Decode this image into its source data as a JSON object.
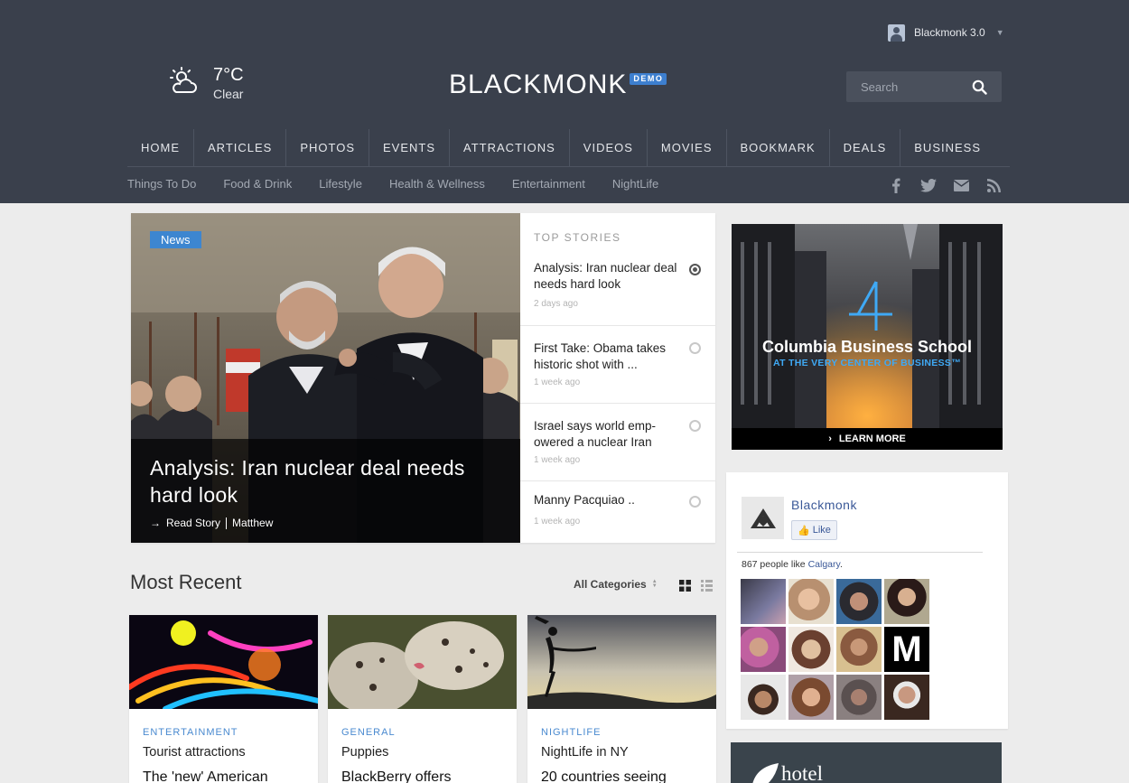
{
  "user": {
    "name": "Blackmonk 3.0"
  },
  "weather": {
    "temp": "7°C",
    "condition": "Clear"
  },
  "logo": {
    "text": "BLACKMONK",
    "badge": "DEMO"
  },
  "search": {
    "placeholder": "Search"
  },
  "nav": [
    "HOME",
    "ARTICLES",
    "PHOTOS",
    "EVENTS",
    "ATTRACTIONS",
    "VIDEOS",
    "MOVIES",
    "BOOKMARK",
    "DEALS",
    "BUSINESS"
  ],
  "subnav": [
    "Things To Do",
    "Food & Drink",
    "Lifestyle",
    "Health & Wellness",
    "Entertainment",
    "NightLife"
  ],
  "social": [
    "facebook-icon",
    "twitter-icon",
    "mail-icon",
    "rss-icon"
  ],
  "hero": {
    "badge": "News",
    "title": "Analysis: Iran nuclear deal needs hard look",
    "read_story": "Read Story",
    "author": "Matthew"
  },
  "top_stories": {
    "heading": "TOP STORIES",
    "items": [
      {
        "title": "Analysis: Iran nuclear deal needs hard look",
        "time": "2 days ago"
      },
      {
        "title": "First Take: Obama takes historic shot with ...",
        "time": "1 week ago"
      },
      {
        "title": "Israel says world emp-owered a nuclear Iran",
        "time": "1 week ago"
      },
      {
        "title": "Manny Pacquiao ..",
        "time": "1 week ago"
      }
    ]
  },
  "ad": {
    "title": "Columbia Business School",
    "tagline": "AT THE VERY CENTER OF BUSINESS™",
    "cta": "LEARN MORE"
  },
  "fb": {
    "name": "Blackmonk",
    "like": "Like",
    "count_prefix": "867 people like ",
    "count_link": "Calgary",
    "count_suffix": "."
  },
  "hotel": {
    "text": "hotel"
  },
  "most_recent": {
    "title": "Most Recent",
    "category_select": "All Categories",
    "cards": [
      {
        "category": "ENTERTAINMENT",
        "title": "Tourist attractions",
        "sub": "The 'new' American"
      },
      {
        "category": "GENERAL",
        "title": "Puppies",
        "sub": "BlackBerry offers"
      },
      {
        "category": "NIGHTLIFE",
        "title": "NightLife in NY",
        "sub": "20 countries seeing"
      }
    ]
  },
  "colors": {
    "header_bg": "#3a404c",
    "accent": "#3d86d0",
    "fb_blue": "#3b5998"
  }
}
